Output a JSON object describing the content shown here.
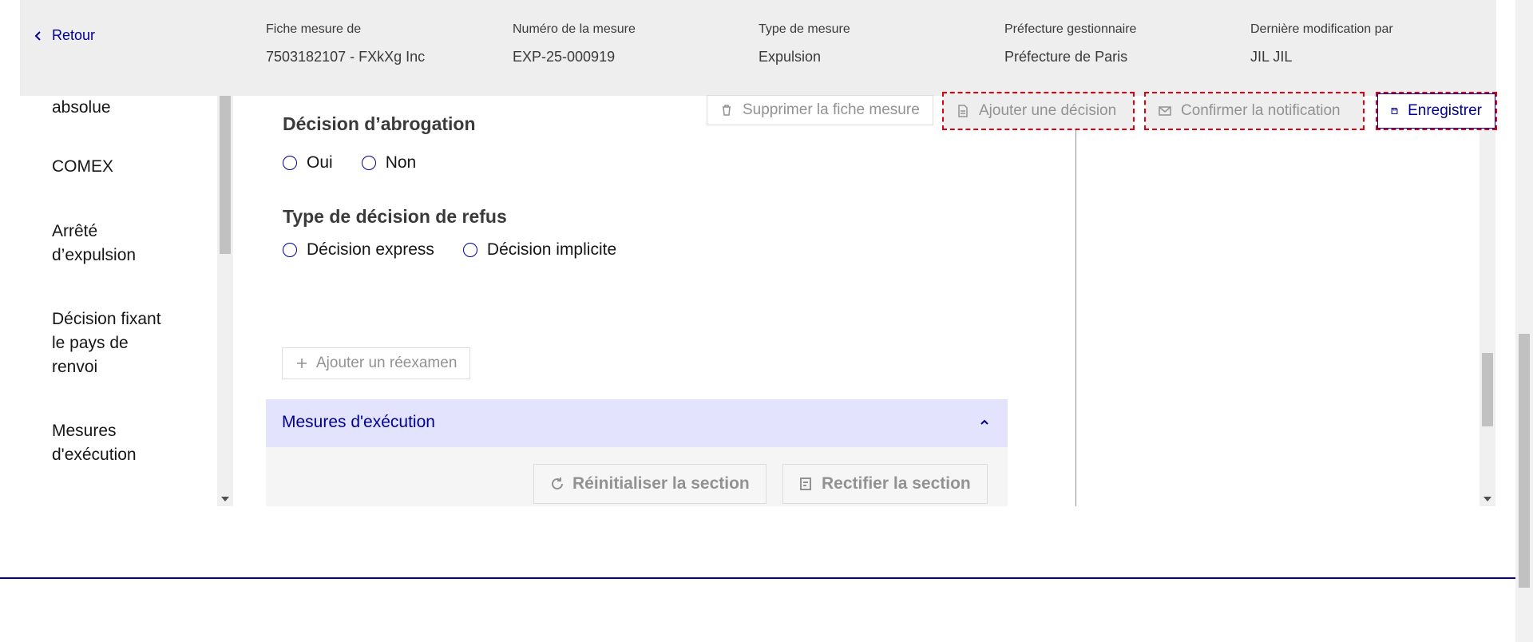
{
  "header": {
    "back_label": "Retour",
    "fields": [
      {
        "label": "Fiche mesure de",
        "value": "7503182107 - FXkXg Inc"
      },
      {
        "label": "Numéro de la mesure",
        "value": "EXP-25-000919"
      },
      {
        "label": "Type de mesure",
        "value": "Expulsion"
      },
      {
        "label": "Préfecture gestionnaire",
        "value": "Préfecture de Paris"
      },
      {
        "label": "Dernière modification par",
        "value": "JIL JIL"
      }
    ]
  },
  "sidebar": {
    "items": [
      {
        "label": "absolue"
      },
      {
        "label": "COMEX"
      },
      {
        "label": "Arrêté d’expulsion"
      },
      {
        "label": "Décision fixant le pays de renvoi"
      },
      {
        "label": "Mesures d'exécution"
      }
    ]
  },
  "actions": {
    "delete_label": "Supprimer la fiche mesure",
    "add_decision_label": "Ajouter une décision",
    "confirm_notification_label": "Confirmer la notification",
    "save_label": "Enregistrer"
  },
  "main": {
    "abrogation": {
      "title": "Décision d’abrogation",
      "options": [
        "Oui",
        "Non"
      ]
    },
    "refusal": {
      "title": "Type de décision de refus",
      "options": [
        "Décision express",
        "Décision implicite"
      ]
    },
    "add_reexam_label": "Ajouter un réexamen",
    "execution_section": {
      "title": "Mesures d'exécution",
      "reset_label": "Réinitialiser la section",
      "rectify_label": "Rectifier la section"
    }
  },
  "colors": {
    "primary": "#000091",
    "header_bg": "#eeeeee",
    "section_bg": "#e3e3fd",
    "dashed_outline": "#e1000f",
    "disabled_text": "#929292"
  }
}
